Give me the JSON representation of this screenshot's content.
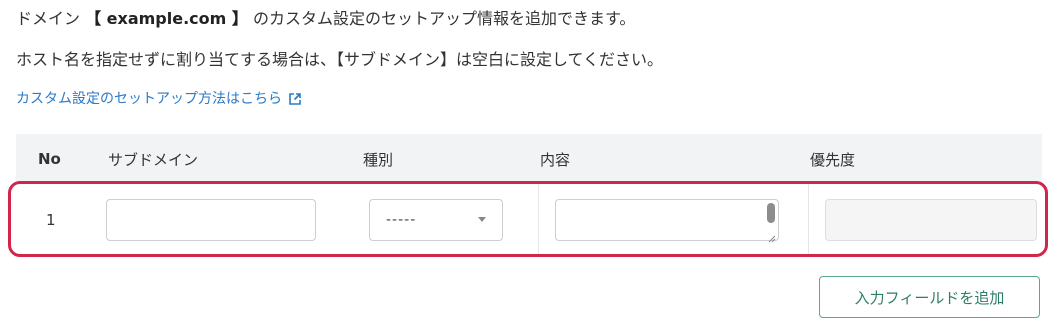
{
  "intro": {
    "line1_prefix": "ドメイン ",
    "domain": "【 example.com 】",
    "line1_suffix": " のカスタム設定のセットアップ情報を追加できます。",
    "line2": "ホスト名を指定せずに割り当てする場合は、【サブドメイン】は空白に設定してください。"
  },
  "help_link": {
    "label": "カスタム設定のセットアップ方法はこちら",
    "icon": "external-link-icon",
    "color": "#2a7ac7"
  },
  "table": {
    "headers": {
      "no": "No",
      "subdomain": "サブドメイン",
      "type": "種別",
      "content": "内容",
      "priority": "優先度"
    },
    "rows": [
      {
        "no": "1",
        "subdomain": "",
        "type": "-----",
        "content": "",
        "priority": ""
      }
    ]
  },
  "highlight_color": "#d2254a",
  "add_button": {
    "label": "入力フィールドを追加",
    "color": "#2e7d66"
  }
}
